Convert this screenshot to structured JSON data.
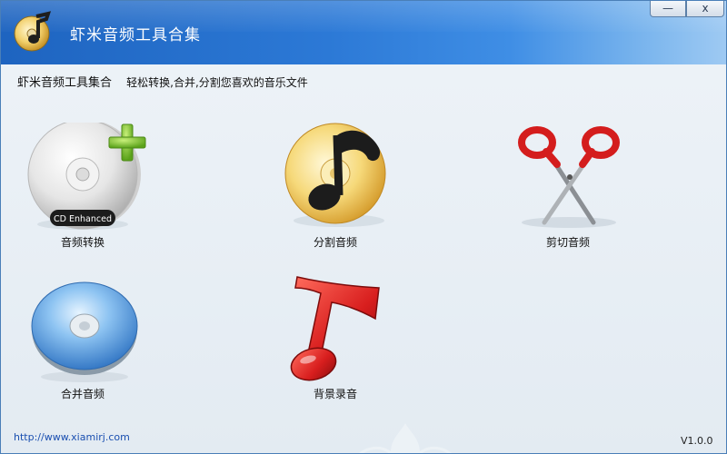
{
  "window": {
    "title": "虾米音频工具合集",
    "minimize_label": "—",
    "close_label": "x"
  },
  "header": {
    "title": "虾米音频工具集合",
    "description": "轻松转换,合并,分割您喜欢的音乐文件"
  },
  "tools": [
    {
      "label": "音频转换",
      "icon": "cd-enhanced-icon",
      "badge": "CD Enhanced"
    },
    {
      "label": "分割音频",
      "icon": "music-disc-icon"
    },
    {
      "label": "剪切音频",
      "icon": "scissors-icon"
    },
    {
      "label": "合并音频",
      "icon": "blue-disc-icon"
    },
    {
      "label": "背景录音",
      "icon": "red-music-note-icon"
    }
  ],
  "footer": {
    "url": "http://www.xiamirj.com",
    "version": "V1.0.0"
  },
  "colors": {
    "titlebar": "#2c79d6",
    "background": "#e6edf3",
    "link": "#1a4fb0"
  }
}
